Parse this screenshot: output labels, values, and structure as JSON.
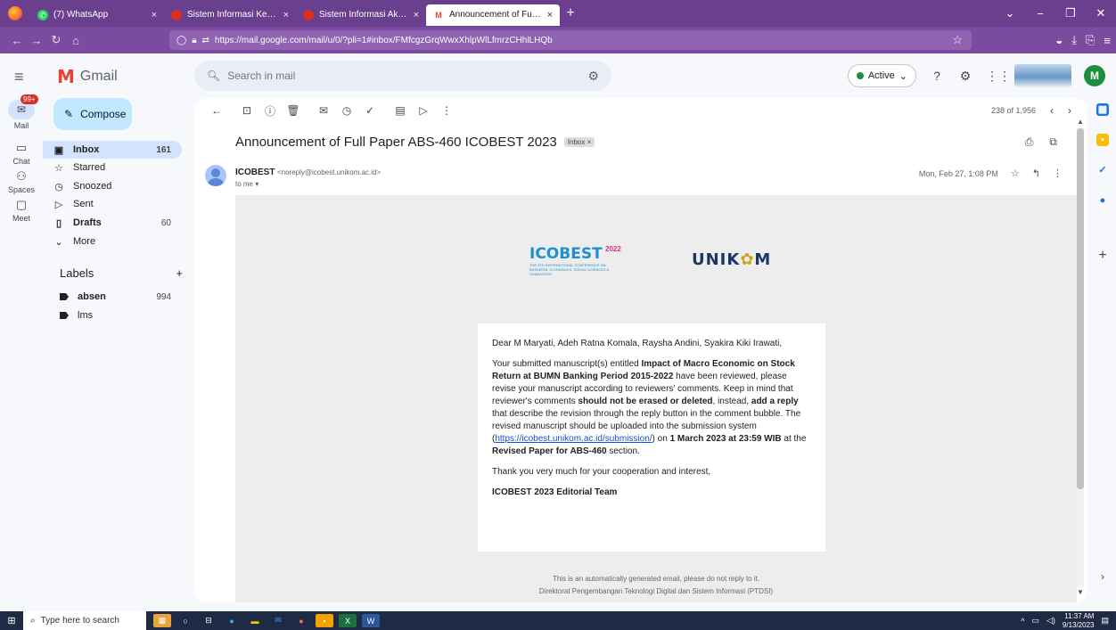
{
  "browser": {
    "tabs": [
      {
        "label": "(7) WhatsApp",
        "icon": "whatsapp-icon",
        "color": "#25d366"
      },
      {
        "label": "Sistem Informasi Keuangan",
        "icon": "app-icon",
        "color": "#d93025"
      },
      {
        "label": "Sistem Informasi Akademik (PI",
        "icon": "app-icon",
        "color": "#d93025"
      },
      {
        "label": "Announcement of Full Paper A",
        "icon": "gmail-icon",
        "color": "#ea4335"
      }
    ],
    "url": "https://mail.google.com/mail/u/0/?pli=1#inbox/FMfcgzGrqWwxXhlpWlLfmrzCHhlLHQb"
  },
  "gmail": {
    "app_name": "Gmail",
    "search_placeholder": "Search in mail",
    "status": "Active",
    "avatar_letter": "M",
    "compose": "Compose"
  },
  "rail": [
    {
      "label": "Mail",
      "icon": "mail-icon",
      "badge": "99+"
    },
    {
      "label": "Chat",
      "icon": "chat-icon"
    },
    {
      "label": "Spaces",
      "icon": "spaces-icon"
    },
    {
      "label": "Meet",
      "icon": "meet-icon"
    }
  ],
  "nav": [
    {
      "label": "Inbox",
      "count": "161",
      "icon": "inbox-icon"
    },
    {
      "label": "Starred",
      "count": "",
      "icon": "star-icon"
    },
    {
      "label": "Snoozed",
      "count": "",
      "icon": "clock-icon"
    },
    {
      "label": "Sent",
      "count": "",
      "icon": "send-icon"
    },
    {
      "label": "Drafts",
      "count": "60",
      "icon": "draft-icon"
    },
    {
      "label": "More",
      "count": "",
      "icon": "chevron-down-icon"
    }
  ],
  "labels": {
    "title": "Labels",
    "items": [
      {
        "label": "absen",
        "count": "994"
      },
      {
        "label": "lms",
        "count": ""
      }
    ]
  },
  "message": {
    "pager": "238 of 1,956",
    "subject": "Announcement of Full Paper ABS-460 ICOBEST 2023",
    "inbox_chip": "Inbox ×",
    "sender_name": "ICOBEST",
    "sender_email": "<noreply@icobest.unikom.ac.id>",
    "to": "to me ▾",
    "date": "Mon, Feb 27, 1:08 PM",
    "body": {
      "logo_left": "ICOBEST",
      "logo_left_year": "2022",
      "logo_left_small": "THE 4TH INTERNATIONAL CONFERENCE ON BUSINESS, ECONOMICS, SOCIAL SCIENCES & HUMANITIES",
      "logo_right_a": "UNIK",
      "logo_right_b": "M",
      "greeting": "Dear M Maryati, Adeh Ratna Komala, Raysha Andini, Syakira Kiki Irawati,",
      "p1_a": "Your submitted manuscript(s) entitled ",
      "p1_title": "Impact of Macro Economic on Stock Return at BUMN Banking Period 2015-2022",
      "p1_b": " have been reviewed, please revise your manuscript according to reviewers' comments. Keep in mind that reviewer's comments ",
      "p1_strong1": "should not be erased or deleted",
      "p1_c": ", instead, ",
      "p1_strong2": "add a reply",
      "p1_d": " that describe the revision through the reply button in the comment bubble. The revised manuscript should be uploaded into the submission system (",
      "p1_link": "https://icobest.unikom.ac.id/submission/",
      "p1_e": ") on ",
      "p1_deadline": "1 March 2023 at 23:59 WIB",
      "p1_f": " at the ",
      "p1_section": "Revised Paper for ABS-460",
      "p1_g": " section.",
      "thanks": "Thank you very much for your cooperation and interest,",
      "signature": "ICOBEST 2023 Editorial Team",
      "footer1": "This is an automatically generated email, please do not reply to it.",
      "footer2": "Direktorat Pengembangan Teknologi Digital dan Sistem Informasi (PTDSI)"
    }
  },
  "taskbar": {
    "search_placeholder": "Type here to search",
    "time": "11:37 AM",
    "date": "9/13/2023"
  },
  "colors": {
    "firefox_tabbar": "#6a3f8e",
    "firefox_navbar": "#7b4b9f",
    "gmail_selected": "#d3e3fd",
    "compose": "#c2e7ff",
    "taskbar": "#1f2a44"
  }
}
